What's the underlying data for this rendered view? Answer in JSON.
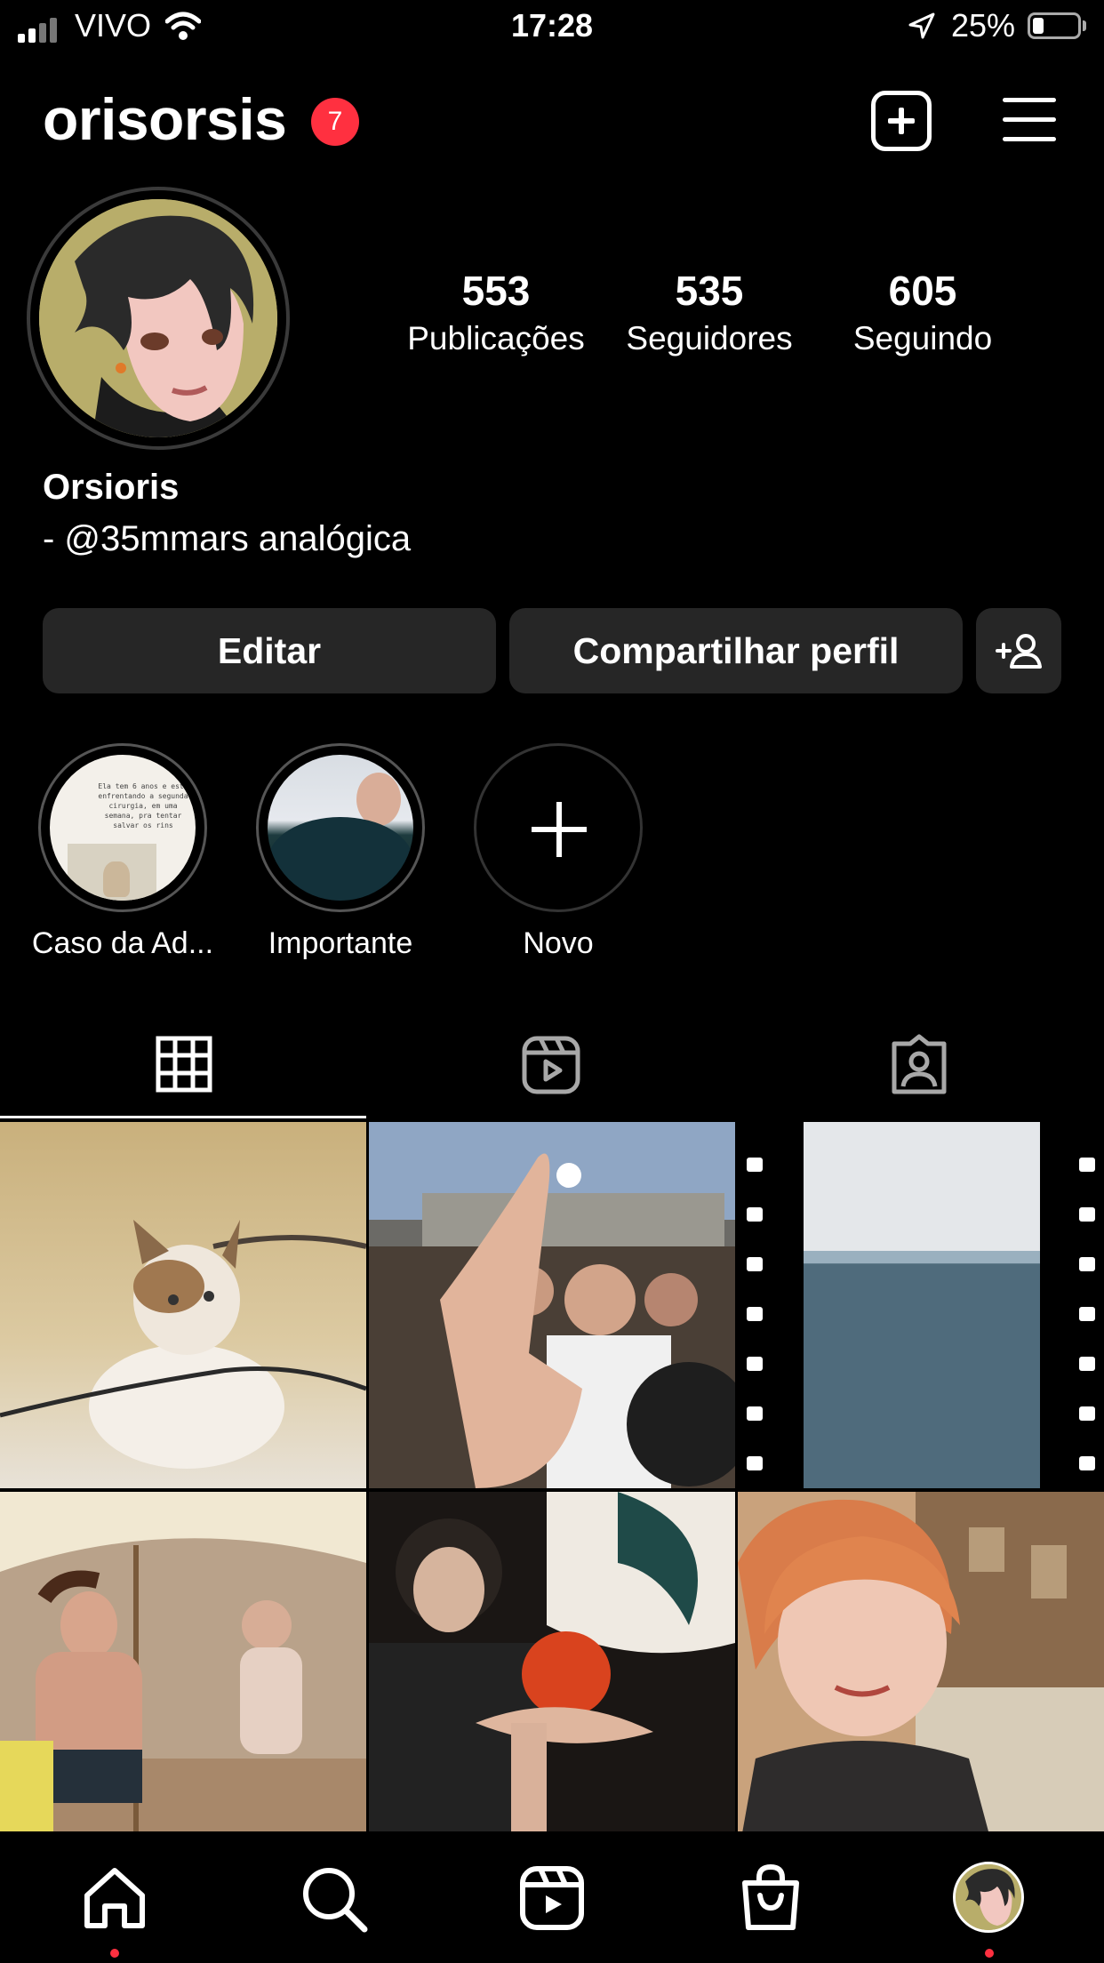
{
  "status_bar": {
    "carrier": "VIVO",
    "time": "17:28",
    "battery_percent": "25%"
  },
  "header": {
    "username": "orisorsis",
    "notification_count": "7"
  },
  "profile": {
    "display_name": "Orsioris",
    "bio": "- @35mmars analógica",
    "stats": [
      {
        "value": "553",
        "label": "Publicações"
      },
      {
        "value": "535",
        "label": "Seguidores"
      },
      {
        "value": "605",
        "label": "Seguindo"
      }
    ]
  },
  "actions": {
    "edit_label": "Editar",
    "share_label": "Compartilhar perfil"
  },
  "highlights": [
    {
      "label": "Caso da Ad...",
      "cover_text": "Ela tem 6 anos e está enfrentando a segunda cirurgia, em uma semana, pra tentar salvar os rins"
    },
    {
      "label": "Importante"
    },
    {
      "label": "Novo"
    }
  ],
  "tabs": [
    {
      "name": "grid",
      "icon": "grid-icon",
      "active": true
    },
    {
      "name": "reels",
      "icon": "reels-icon",
      "active": false
    },
    {
      "name": "tagged",
      "icon": "tagged-icon",
      "active": false
    }
  ],
  "posts": [
    {
      "subject": "cat"
    },
    {
      "subject": "crowd"
    },
    {
      "subject": "sea"
    },
    {
      "subject": "beach"
    },
    {
      "subject": "bowl"
    },
    {
      "subject": "portrait"
    }
  ],
  "bottom_nav": [
    {
      "icon": "home-icon",
      "active": true
    },
    {
      "icon": "search-icon"
    },
    {
      "icon": "reels-icon"
    },
    {
      "icon": "shop-icon"
    },
    {
      "icon": "profile-avatar"
    }
  ],
  "colors": {
    "background": "#000000",
    "button_bg": "#262626",
    "badge": "#ff3040"
  }
}
